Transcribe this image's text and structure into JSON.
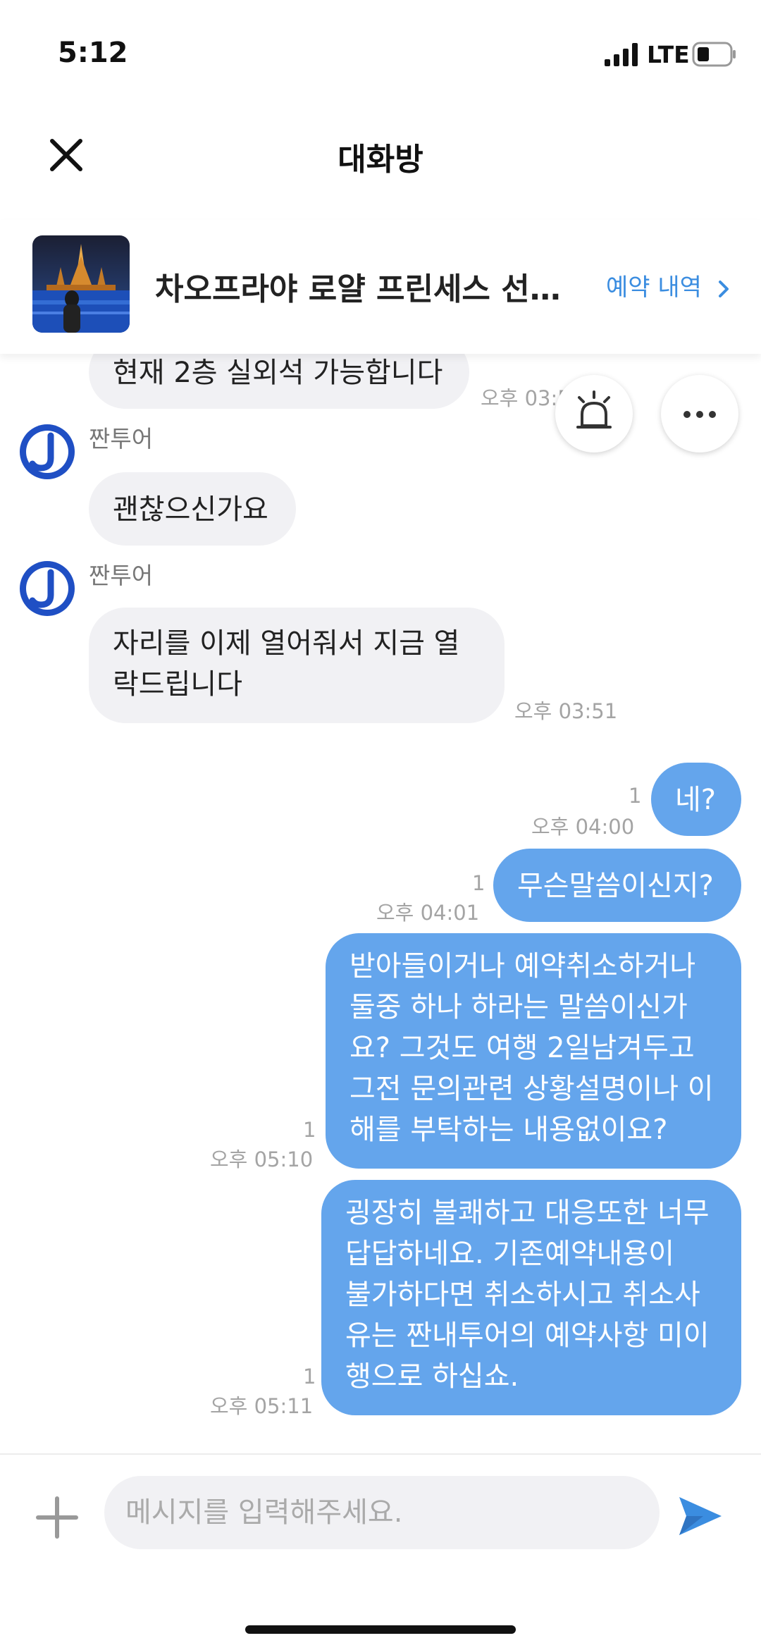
{
  "status_bar": {
    "time": "5:12",
    "network": "LTE"
  },
  "header": {
    "title": "대화방",
    "close_icon": "close-icon"
  },
  "product": {
    "name": "차오프라야 로얄 프린세스 선셋...",
    "booking_link": "예약 내역",
    "chevron_icon": "chevron-right-icon"
  },
  "messages": [
    {
      "type": "in",
      "text": "현재 2층 실외석 가능합니다",
      "time": "오후 03:5"
    },
    {
      "type": "in",
      "sender": "짠투어",
      "text": "괜찮으신가요"
    },
    {
      "type": "in",
      "sender": "짠투어",
      "lines": [
        "자리를 이제 열어줘서 지금 열",
        "락드립니다"
      ],
      "time": "오후 03:51"
    },
    {
      "type": "out",
      "read": "1",
      "text": "네?",
      "time": "오후 04:00"
    },
    {
      "type": "out",
      "read": "1",
      "text": "무슨말씀이신지?",
      "time": "오후 04:01"
    },
    {
      "type": "out",
      "read": "1",
      "lines": [
        "받아들이거나 예약취소하거나",
        "둘중 하나 하라는 말씀이신가",
        "요? 그것도 여행 2일남겨두고",
        "그전 문의관련 상황설명이나 이",
        "해를 부탁하는 내용없이요?"
      ],
      "time": "오후 05:10"
    },
    {
      "type": "out",
      "read": "1",
      "lines": [
        "굉장히 불쾌하고 대응또한 너무",
        "답답하네요.  기존예약내용이",
        "불가하다면 취소하시고 취소사",
        "유는 짠내투어의 예약사항 미이",
        "행으로 하십쇼."
      ],
      "time": "오후 05:11"
    }
  ],
  "input": {
    "placeholder": "메시지를 입력해주세요."
  },
  "colors": {
    "accent": "#3b8de0",
    "outgoing_bubble": "#64a5ec",
    "incoming_bubble": "#f1f1f4"
  }
}
